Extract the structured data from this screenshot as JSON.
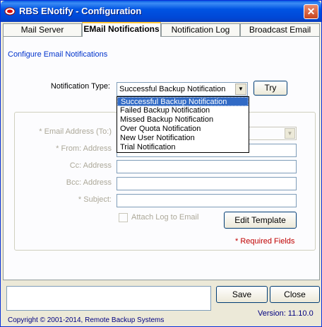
{
  "window": {
    "title": "RBS ENotify - Configuration",
    "close_glyph": "✕"
  },
  "tabs": [
    {
      "label": "Mail Server"
    },
    {
      "label": "EMail Notifications"
    },
    {
      "label": "Notification Log"
    },
    {
      "label": "Broadcast Email"
    }
  ],
  "panel": {
    "heading": "Configure Email Notifications",
    "notification_type_label": "Notification Type:",
    "notification_type_value": "Successful Backup Notification",
    "try_label": "Try",
    "email_to_label": "* Email Address (To:)",
    "from_label": "* From: Address",
    "cc_label": "Cc: Address",
    "bcc_label": "Bcc: Address",
    "subject_label": "* Subject:",
    "attach_log_label": "Attach Log to Email",
    "edit_template_label": "Edit Template",
    "required_label": "* Required Fields"
  },
  "dropdown": {
    "options": [
      "Successful Backup Notification",
      "Failed Backup Notification",
      "Missed Backup Notification",
      "Over Quota Notification",
      "New User Notification",
      "Trial Notification"
    ],
    "selected_index": 0
  },
  "footer": {
    "save_label": "Save",
    "close_label": "Close",
    "copyright": "Copyright © 2001-2014, Remote Backup Systems",
    "version": "Version: 11.10.0"
  },
  "colors": {
    "title_bar": "#0054e3",
    "heading_blue": "#0033cc",
    "required_red": "#c00000",
    "selection": "#316ac5"
  }
}
